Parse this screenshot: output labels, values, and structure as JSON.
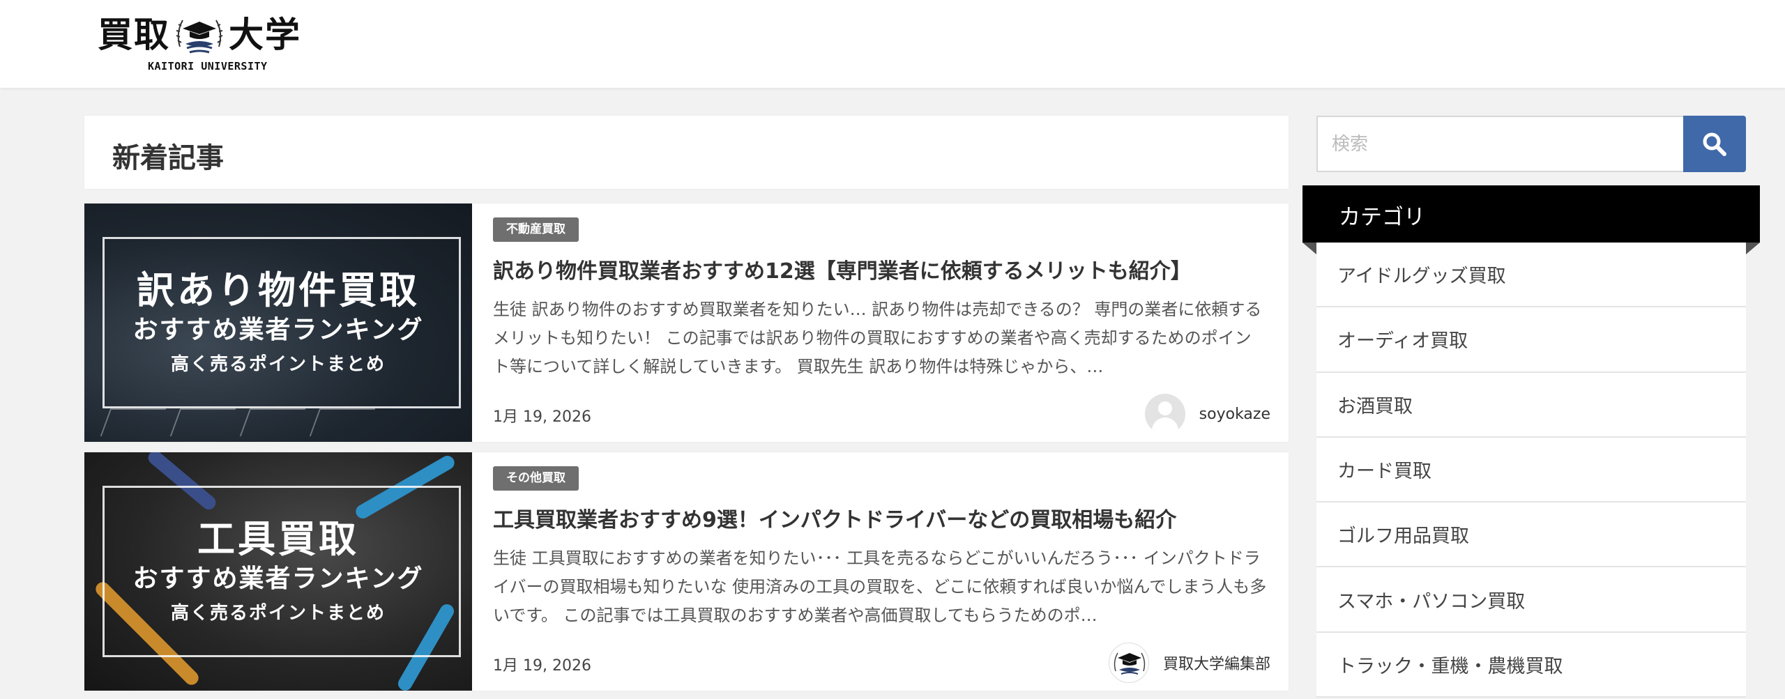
{
  "header": {
    "logo_kanji_left": "買取",
    "logo_kanji_right": "大学",
    "logo_sub": "KAITORI UNIVERSITY"
  },
  "section": {
    "title": "新着記事"
  },
  "articles": [
    {
      "category": "不動産買取",
      "title": "訳あり物件買取業者おすすめ12選【専門業者に依頼するメリットも紹介】",
      "excerpt": "生徒 訳あり物件のおすすめ買取業者を知りたい… 訳あり物件は売却できるの？ 専門の業者に依頼するメリットも知りたい！ この記事では訳あり物件の買取におすすめの業者や高く売却するためのポイント等について詳しく解説していきます。 買取先生 訳あり物件は特殊じゃから、…",
      "date": "1月 19, 2026",
      "author": "soyokaze",
      "thumb": {
        "line1": "訳あり物件買取",
        "line2": "おすすめ業者ランキング",
        "line3": "高く売るポイントまとめ"
      }
    },
    {
      "category": "その他買取",
      "title": "工具買取業者おすすめ9選！インパクトドライバーなどの買取相場も紹介",
      "excerpt": "生徒 工具買取におすすめの業者を知りたい･･･ 工具を売るならどこがいいんだろう･･･ インパクトドライバーの買取相場も知りたいな 使用済みの工具の買取を、どこに依頼すれば良いか悩んでしまう人も多いです。 この記事では工具買取のおすすめ業者や高価買取してもらうためのポ…",
      "date": "1月 19, 2026",
      "author": "買取大学編集部",
      "thumb": {
        "line1": "工具買取",
        "line2": "おすすめ業者ランキング",
        "line3": "高く売るポイントまとめ"
      }
    }
  ],
  "sidebar": {
    "search_placeholder": "検索",
    "category_title": "カテゴリ",
    "categories": [
      "アイドルグッズ買取",
      "オーディオ買取",
      "お酒買取",
      "カード買取",
      "ゴルフ用品買取",
      "スマホ・パソコン買取",
      "トラック・重機・農機買取"
    ]
  },
  "colors": {
    "search_button": "#3f69a9",
    "category_header": "#000000",
    "badge": "#6f6f6f"
  },
  "icons": {
    "search": "search-icon",
    "logo": "graduation-cap-emblem",
    "avatar": "default-user-avatar"
  }
}
